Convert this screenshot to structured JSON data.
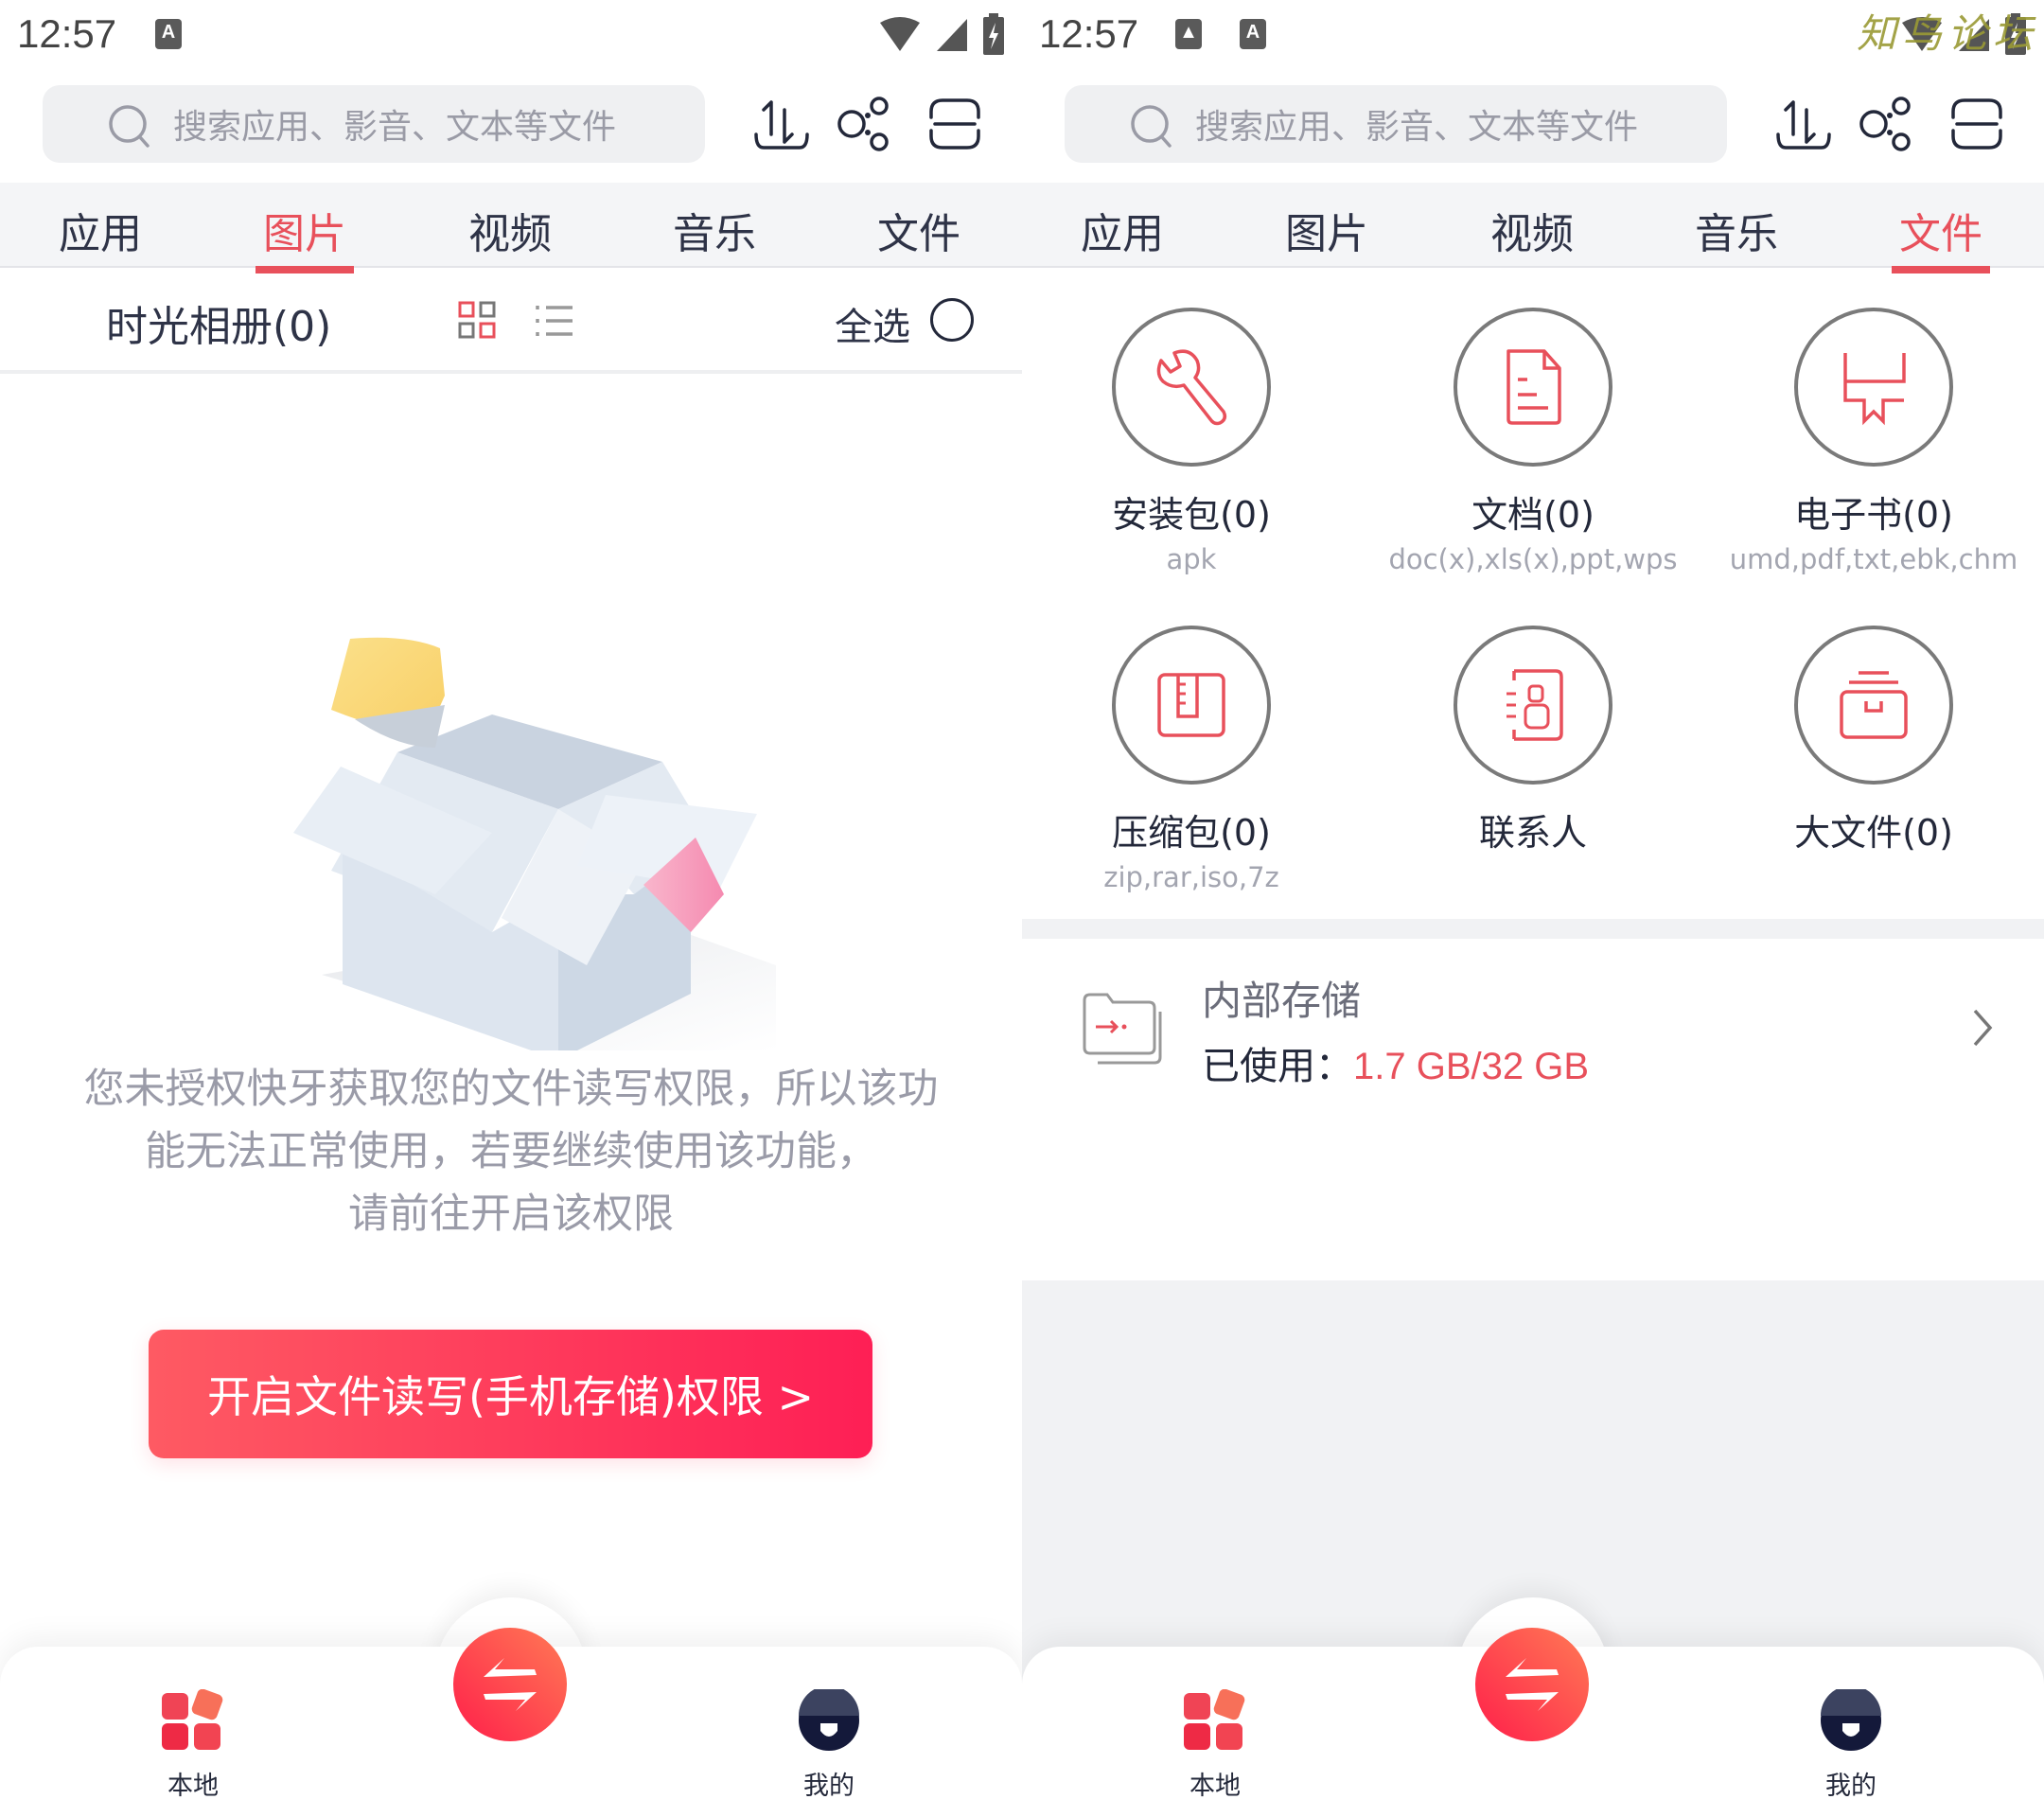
{
  "status_bar": {
    "time": "12:57"
  },
  "watermark": "知鸟论坛",
  "search": {
    "placeholder": "搜索应用、影音、文本等文件"
  },
  "header_icons": [
    "transfer-icon",
    "share-icon",
    "menu-icon"
  ],
  "tabs": [
    {
      "label": "应用"
    },
    {
      "label": "图片"
    },
    {
      "label": "视频"
    },
    {
      "label": "音乐"
    },
    {
      "label": "文件"
    }
  ],
  "left": {
    "active_tab": "图片",
    "album_title": "时光相册(0)",
    "select_all": "全选",
    "message_lines": [
      "您未授权快牙获取您的文件读写权限，所以该功",
      "能无法正常使用，若要继续使用该功能，",
      "请前往开启该权限"
    ],
    "permission_button": "开启文件读写(手机存储)权限 >"
  },
  "right": {
    "active_tab": "文件",
    "categories": [
      {
        "label": "安装包(0)",
        "sub": "apk",
        "icon": "wrench-icon"
      },
      {
        "label": "文档(0)",
        "sub": "doc(x),xls(x),ppt,wps",
        "icon": "document-icon"
      },
      {
        "label": "电子书(0)",
        "sub": "umd,pdf,txt,ebk,chm",
        "icon": "ebook-icon"
      },
      {
        "label": "压缩包(0)",
        "sub": "zip,rar,iso,7z",
        "icon": "zip-icon"
      },
      {
        "label": "联系人",
        "sub": "",
        "icon": "contacts-icon"
      },
      {
        "label": "大文件(0)",
        "sub": "",
        "icon": "large-file-icon"
      }
    ],
    "storage": {
      "title": "内部存储",
      "used_label": "已使用：",
      "used_value": "1.7 GB/32 GB"
    }
  },
  "bottom_nav": {
    "local": "本地",
    "mine": "我的"
  },
  "colors": {
    "accent": "#e8505b",
    "button_start": "#fe5a63",
    "button_end": "#fe1f55"
  }
}
